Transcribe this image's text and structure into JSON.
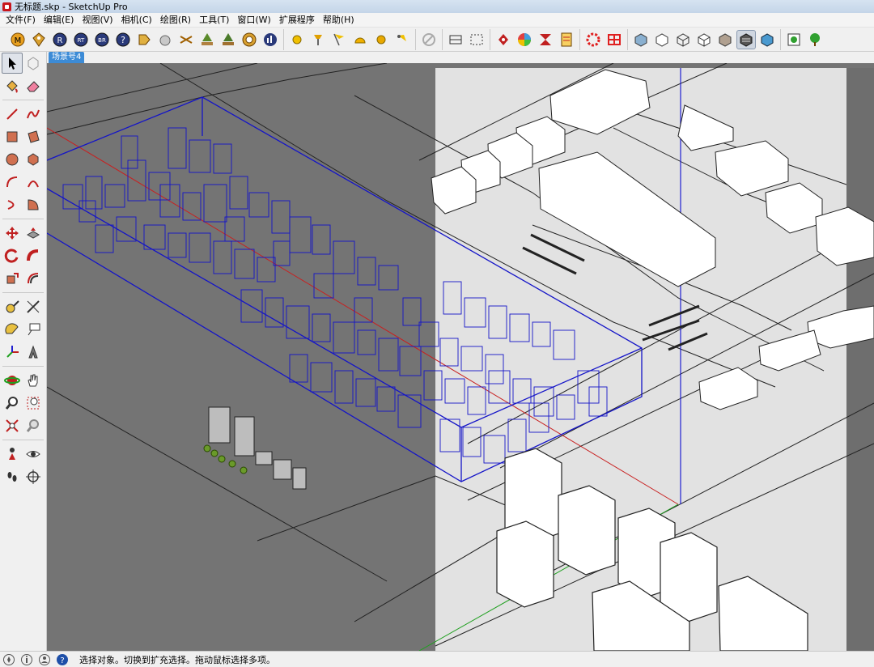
{
  "window": {
    "title": "无标题.skp - SketchUp Pro"
  },
  "menu": [
    "文件(F)",
    "编辑(E)",
    "视图(V)",
    "相机(C)",
    "绘图(R)",
    "工具(T)",
    "窗口(W)",
    "扩展程序",
    "帮助(H)"
  ],
  "scene": {
    "tab_label": "场景号4"
  },
  "status": {
    "message": "选择对象。切换到扩充选择。拖动鼠标选择多项。"
  },
  "colors": {
    "viewport_gray": "#747474",
    "highlight_panel": "#e2e2e2",
    "selection_blue": "#1414c8",
    "axis_red": "#c82020",
    "axis_green": "#20a020",
    "axis_blue": "#2020d0",
    "scene_tab": "#3c8bd6"
  },
  "toolbar_icons": [
    [
      "extension-m-icon",
      "extension-tag-icon",
      "extension-r-icon",
      "extension-rt-icon",
      "extension-br-icon",
      "help-icon",
      "tag-tool-icon",
      "sphere-icon",
      "scissors-icon",
      "tree-icon",
      "tree2-icon",
      "target-icon",
      "chart-icon"
    ],
    [
      "sun-icon",
      "lamp-icon",
      "flag-icon",
      "dome-icon",
      "orb-icon",
      "spotlight-icon"
    ],
    [
      "no-entry-icon"
    ],
    [
      "section-icon",
      "dashed-box-icon"
    ],
    [
      "component-icon",
      "color-wheel-icon",
      "crop-icon",
      "report-icon"
    ],
    [
      "gear-red-icon",
      "grid-red-icon"
    ],
    [
      "xray-icon",
      "back-edges-icon",
      "wireframe-icon",
      "hidden-line-icon",
      "shaded-icon",
      "shaded-textures-icon",
      "monochrome-icon"
    ],
    [
      "scene-model-icon",
      "tree-green-icon"
    ]
  ],
  "left_tools": [
    [
      "select-arrow-icon",
      "component-icon"
    ],
    [
      "paint-bucket-icon",
      "eraser-icon"
    ],
    [
      "pencil-line-icon",
      "freehand-icon"
    ],
    [
      "rectangle-icon",
      "rotated-rectangle-icon"
    ],
    [
      "circle-icon",
      "polygon-icon"
    ],
    [
      "arc-icon",
      "two-point-arc-icon"
    ],
    [
      "three-point-arc-icon",
      "pie-icon"
    ],
    [
      "move-icon",
      "push-pull-icon"
    ],
    [
      "rotate-icon",
      "follow-me-icon"
    ],
    [
      "scale-icon",
      "offset-icon"
    ],
    [
      "tape-measure-icon",
      "dimension-icon"
    ],
    [
      "protractor-icon",
      "text-icon"
    ],
    [
      "axes-icon",
      "3d-text-icon"
    ],
    [
      "orbit-icon",
      "pan-hand-icon"
    ],
    [
      "zoom-icon",
      "zoom-window-icon"
    ],
    [
      "zoom-extents-icon",
      "previous-view-icon"
    ],
    [
      "position-camera-icon",
      "look-around-eye-icon"
    ],
    [
      "walk-footprints-icon",
      "section-plane-icon"
    ]
  ],
  "status_icons": [
    "geo-location-icon",
    "credits-icon",
    "user-account-icon",
    "help-question-icon"
  ]
}
